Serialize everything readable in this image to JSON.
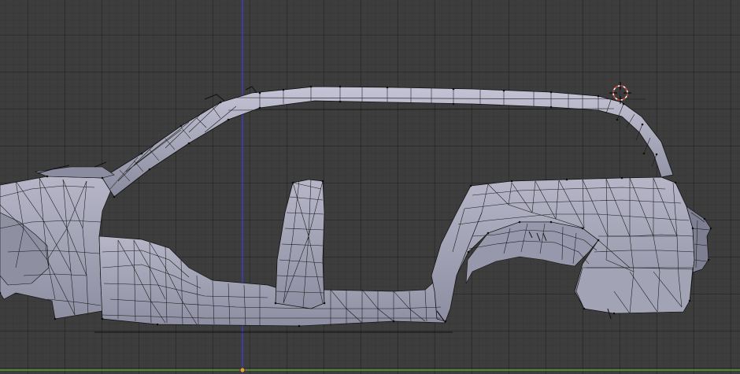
{
  "viewport": {
    "name": "3d-viewport",
    "background": "#3d3d3d",
    "grid_color": "#333333",
    "x_axis_color": "#5aa02c",
    "z_axis_color": "#3f3fff",
    "mesh_fill": "#a9a9bb",
    "mesh_shadow": "#7d7d8f",
    "wire_color": "#111111",
    "selected_edge_color": "#ffffff",
    "origin_color": "#e2a043",
    "cursor_color": "#d03030"
  },
  "objects": {
    "mesh": "car-body-shell-mesh",
    "cursor": "3d-cursor-icon",
    "origin": "object-origin-dot"
  }
}
